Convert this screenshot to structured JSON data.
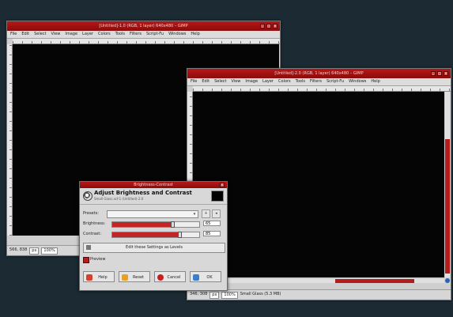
{
  "window1": {
    "title": "[Untitled]-1.0 (RGB, 1 layer) 640x480 – GIMP",
    "menu": [
      "File",
      "Edit",
      "Select",
      "View",
      "Image",
      "Layer",
      "Colors",
      "Tools",
      "Filters",
      "Script-Fu",
      "Windows",
      "Help"
    ],
    "status": {
      "unit": "px",
      "zoom": "100%"
    },
    "position_readout": "566, 838"
  },
  "window2": {
    "title": "[Untitled]-2.0 (RGB, 1 layer) 640x480 – GIMP",
    "menu": [
      "File",
      "Edit",
      "Select",
      "View",
      "Image",
      "Layer",
      "Colors",
      "Tools",
      "Filters",
      "Script-Fu",
      "Windows",
      "Help"
    ],
    "status": {
      "position": "346, 308",
      "unit": "px",
      "zoom": "100%",
      "info": "Small Glass (5.3 MB)"
    }
  },
  "dialog": {
    "title": "Brightness-Contrast",
    "heading": "Adjust Brightness and Contrast",
    "subheading": "Small Glass.xcf-1 (Untitled)-2.0",
    "presets_label": "Presets:",
    "presets_value": "",
    "brightness_label": "Brightness:",
    "brightness_value": "65",
    "brightness_level": 0.7,
    "contrast_label": "Contrast:",
    "contrast_value": "85",
    "contrast_level": 0.78,
    "levels_button": "Edit these Settings as Levels",
    "preview_label": "Preview",
    "buttons": {
      "help": "Help",
      "reset": "Reset",
      "cancel": "Cancel",
      "ok": "OK"
    }
  },
  "colors": {
    "accent": "#b81717",
    "canvas": "#050505",
    "desktop": "#1b2a33"
  },
  "icons": [
    "close-icon",
    "minimize-icon",
    "maximize-icon",
    "brightness-icon",
    "help-icon",
    "reset-icon",
    "cancel-icon",
    "ok-icon",
    "navigate-icon"
  ]
}
